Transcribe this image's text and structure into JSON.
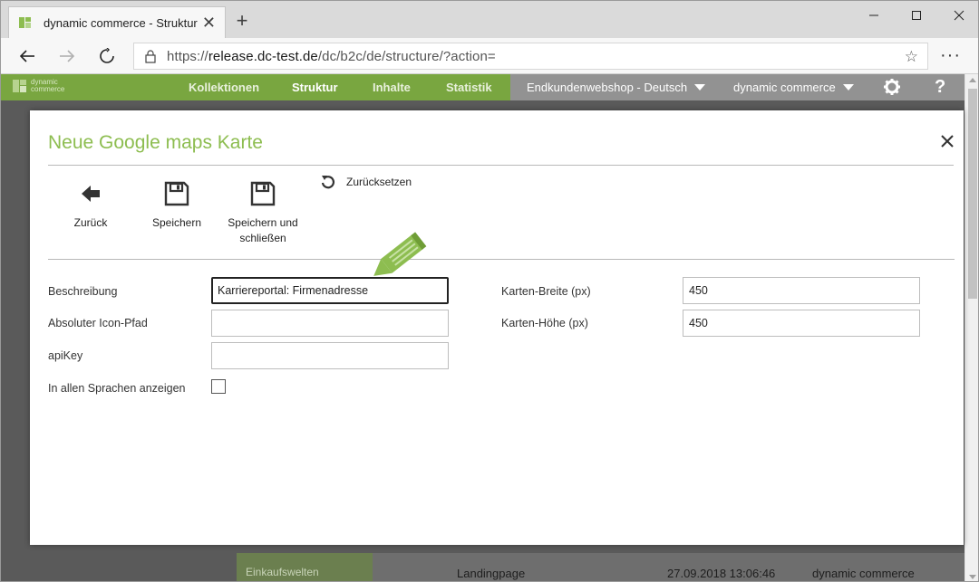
{
  "browser": {
    "tab_title": "dynamic commerce - Struktur",
    "tab_close": "✕",
    "new_tab": "+",
    "url_scheme": "https://",
    "url_host": "release.dc-test.de",
    "url_path": "/dc/b2c/de/structure/?action=",
    "star": "☆",
    "menu": "···"
  },
  "app": {
    "logo_text_1": "dynamic",
    "logo_text_2": "commerce",
    "nav": [
      {
        "label": "Kollektionen"
      },
      {
        "label": "Struktur"
      },
      {
        "label": "Inhalte"
      },
      {
        "label": "Statistik"
      }
    ],
    "shop_select": "Endkundenwebshop - Deutsch",
    "user_select": "dynamic commerce",
    "help_label": "?",
    "accent_color": "#79a640",
    "title_color": "#8dbd50"
  },
  "background": {
    "side_item": "Einkaufswelten",
    "row": {
      "type": "Landingpage",
      "date": "27.09.2018 13:06:46",
      "owner": "dynamic commerce"
    }
  },
  "modal": {
    "title": "Neue Google maps Karte",
    "toolbar": {
      "back": "Zurück",
      "save": "Speichern",
      "save_close_1": "Speichern und",
      "save_close_2": "schließen",
      "reset": "Zurücksetzen"
    },
    "form": {
      "beschreibung_label": "Beschreibung",
      "beschreibung_value": "Karriereportal: Firmenadresse",
      "icon_pfad_label": "Absoluter Icon-Pfad",
      "icon_pfad_value": "",
      "apikey_label": "apiKey",
      "apikey_value": "",
      "sprachen_label": "In allen Sprachen anzeigen",
      "breite_label": "Karten-Breite (px)",
      "breite_value": "450",
      "hoehe_label": "Karten-Höhe (px)",
      "hoehe_value": "450"
    }
  }
}
